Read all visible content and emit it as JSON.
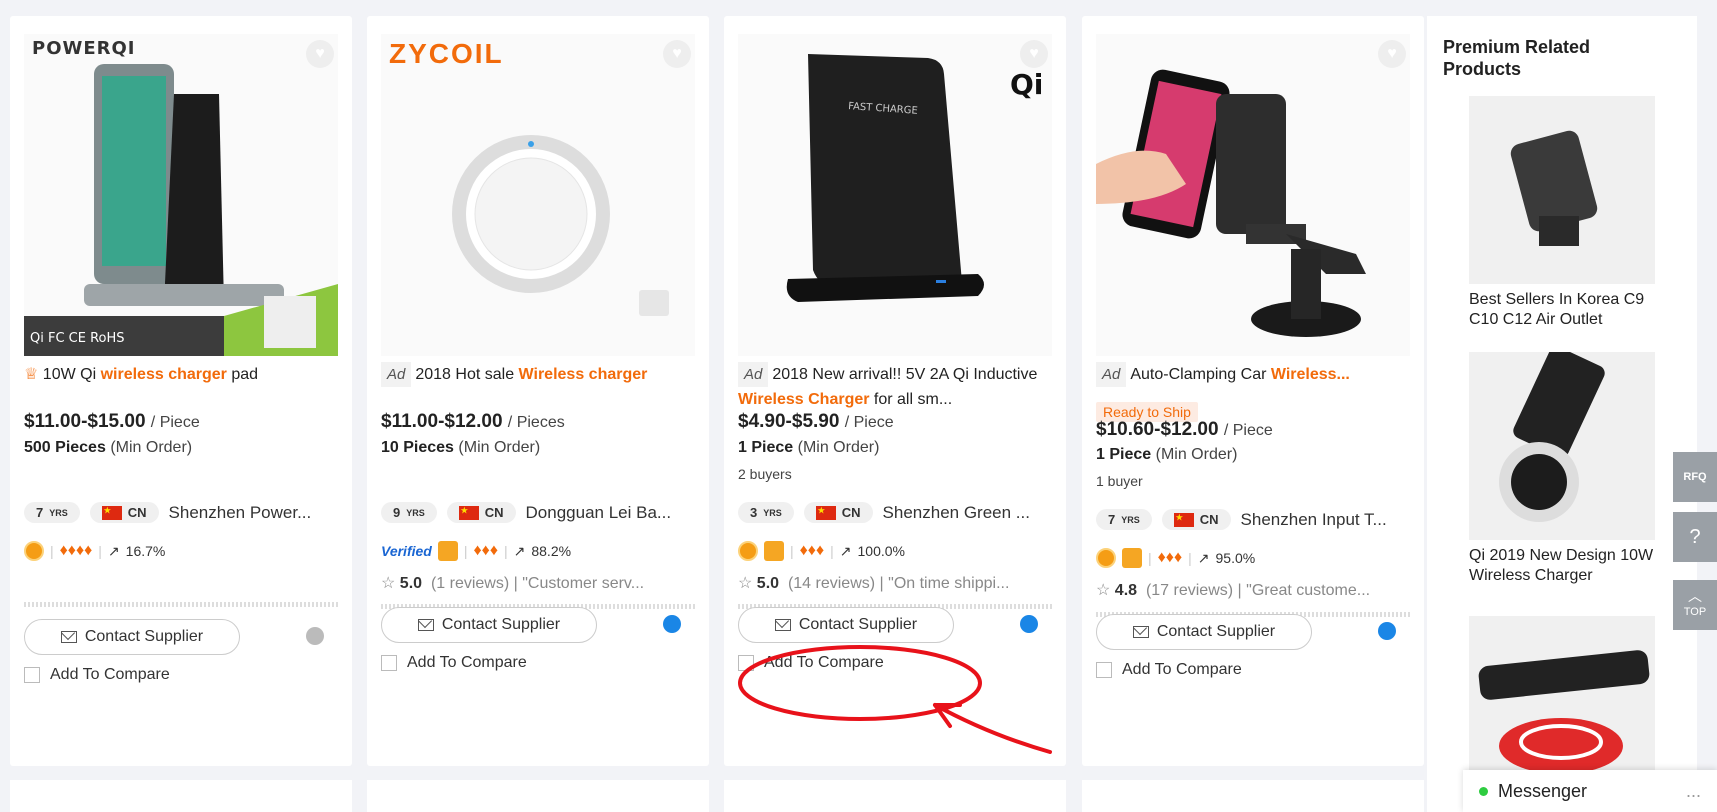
{
  "products": [
    {
      "brand": "POWERQI",
      "ad": "",
      "title_pre": "10W Qi ",
      "title_kw": "wireless charger",
      "title_post": " pad",
      "badge": "",
      "price": "$11.00-$15.00",
      "unit": "/ Piece",
      "moq_qty": "500 Pieces",
      "moq_label": "(Min Order)",
      "buyers": "",
      "years": "7",
      "yrs_label": "YRS",
      "country": "CN",
      "supplier": "Shenzhen Power...",
      "verified": "",
      "response_rate": "16.7%",
      "rating": "",
      "reviews": "",
      "review_quote": "",
      "contact_label": "Contact Supplier",
      "compare_label": "Add To Compare"
    },
    {
      "brand": "ZYCOIL",
      "ad": "Ad",
      "title_pre": "2018 Hot sale ",
      "title_kw": "Wireless charger",
      "title_post": "",
      "badge": "",
      "price": "$11.00-$12.00",
      "unit": "/ Pieces",
      "moq_qty": "10 Pieces",
      "moq_label": "(Min Order)",
      "buyers": "",
      "years": "9",
      "yrs_label": "YRS",
      "country": "CN",
      "supplier": "Dongguan Lei Ba...",
      "verified": "Verified",
      "response_rate": "88.2%",
      "rating": "5.0",
      "reviews": "(1 reviews)",
      "review_quote": "| \"Customer serv...",
      "contact_label": "Contact Supplier",
      "compare_label": "Add To Compare"
    },
    {
      "brand": "",
      "ad": "Ad",
      "title_pre": "2018 New arrival!! 5V 2A Qi Inductive ",
      "title_kw": "Wireless Charger",
      "title_post": " for all sm...",
      "badge": "",
      "price": "$4.90-$5.90",
      "unit": "/ Piece",
      "moq_qty": "1 Piece",
      "moq_label": "(Min Order)",
      "buyers": "2 buyers",
      "years": "3",
      "yrs_label": "YRS",
      "country": "CN",
      "supplier": "Shenzhen Green ...",
      "verified": "",
      "response_rate": "100.0%",
      "rating": "5.0",
      "reviews": "(14 reviews)",
      "review_quote": "| \"On time shippi...",
      "contact_label": "Contact Supplier",
      "compare_label": "Add To Compare",
      "image_text": "FAST CHARGE"
    },
    {
      "brand": "",
      "ad": "Ad",
      "title_pre": "Auto-Clamping Car ",
      "title_kw": "Wireless...",
      "title_post": "",
      "badge": "Ready to Ship",
      "price": "$10.60-$12.00",
      "unit": "/ Piece",
      "moq_qty": "1 Piece",
      "moq_label": "(Min Order)",
      "buyers": "1 buyer",
      "years": "7",
      "yrs_label": "YRS",
      "country": "CN",
      "supplier": "Shenzhen Input T...",
      "verified": "",
      "response_rate": "95.0%",
      "rating": "4.8",
      "reviews": "(17 reviews)",
      "review_quote": "| \"Great custome...",
      "contact_label": "Contact Supplier",
      "compare_label": "Add To Compare"
    }
  ],
  "sidebar": {
    "title": "Premium Related Products",
    "items": [
      {
        "caption": "Best Sellers In Korea C9 C10 C12 Air Outlet"
      },
      {
        "caption": "Qi 2019 New Design 10W Wireless Charger"
      }
    ]
  },
  "float_buttons": {
    "rfq": "RFQ",
    "help": "?",
    "top": "TOP"
  },
  "messenger": {
    "label": "Messenger",
    "dots": "..."
  },
  "colors": {
    "accent": "#f26b0b",
    "annotation": "#e8121a",
    "link": "#1a66d3"
  }
}
